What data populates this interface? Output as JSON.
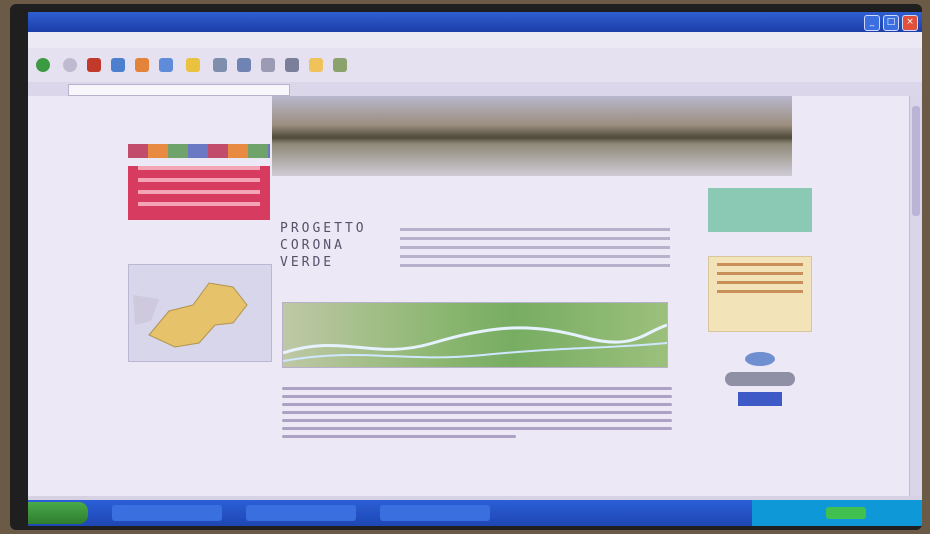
{
  "window": {
    "title": "",
    "buttons": {
      "minimize": "_",
      "maximize": "□",
      "close": "×"
    }
  },
  "menu": [
    "",
    "",
    "",
    ""
  ],
  "toolbar": {
    "back_label": "",
    "search_label": "",
    "favorites_label": ""
  },
  "address": {
    "label": "",
    "value": ""
  },
  "page": {
    "park_lines": [
      "",
      "",
      ""
    ],
    "subtitle": "",
    "progetto": [
      "PROGETTO",
      "CORONA",
      "VERDE"
    ],
    "ribbon_label": "",
    "description": ""
  },
  "taskbar": {
    "start_label": "",
    "tasks": [
      "",
      "",
      ""
    ]
  },
  "colors": {
    "titlebar": "#2f5fd0",
    "accent_red": "#d73b5f",
    "accent_teal": "#8cc9b4",
    "taskbar": "#2b5fd7"
  }
}
